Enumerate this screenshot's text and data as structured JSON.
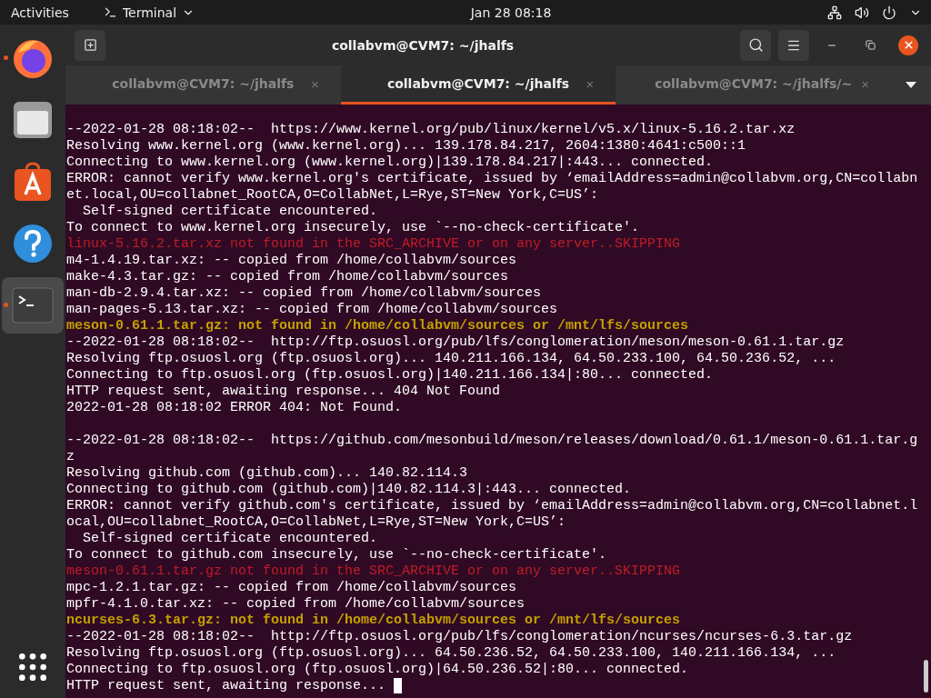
{
  "top_bar": {
    "activities": "Activities",
    "app_menu": "Terminal",
    "clock": "Jan 28  08:18"
  },
  "dock": [
    {
      "kind": "browser",
      "running": true,
      "focused": false
    },
    {
      "kind": "files",
      "running": false,
      "focused": false
    },
    {
      "kind": "software",
      "running": false,
      "focused": false
    },
    {
      "kind": "help",
      "running": false,
      "focused": false
    },
    {
      "kind": "terminal",
      "running": true,
      "focused": true
    }
  ],
  "window": {
    "title": "collabvm@CVM7: ~/jhalfs"
  },
  "tabs": [
    {
      "label": "collabvm@CVM7: ~/jhalfs",
      "close": "×",
      "selected": false
    },
    {
      "label": "collabvm@CVM7: ~/jhalfs",
      "close": "×",
      "selected": true
    },
    {
      "label": "collabvm@CVM7: ~/jhalfs/~",
      "close": "×",
      "selected": false
    }
  ],
  "terminal": {
    "cursor_visible": true,
    "lines": [
      {
        "kind": "normal",
        "text": "--2022-01-28 08:18:02--  https://www.kernel.org/pub/linux/kernel/v5.x/linux-5.16.2.tar.xz"
      },
      {
        "kind": "normal",
        "text": "Resolving www.kernel.org (www.kernel.org)... 139.178.84.217, 2604:1380:4641:c500::1"
      },
      {
        "kind": "normal",
        "text": "Connecting to www.kernel.org (www.kernel.org)|139.178.84.217|:443... connected."
      },
      {
        "kind": "normal",
        "text": "ERROR: cannot verify www.kernel.org's certificate, issued by ‘emailAddress=admin@collabvm.org,CN=collabn"
      },
      {
        "kind": "normal",
        "text": "et.local,OU=collabnet_RootCA,O=CollabNet,L=Rye,ST=New York,C=US’:"
      },
      {
        "kind": "normal",
        "text": "  Self-signed certificate encountered."
      },
      {
        "kind": "normal",
        "text": "To connect to www.kernel.org insecurely, use `--no-check-certificate'."
      },
      {
        "kind": "error",
        "text": "linux-5.16.2.tar.xz not found in the SRC_ARCHIVE or on any server..SKIPPING"
      },
      {
        "kind": "normal",
        "text": "m4-1.4.19.tar.xz: -- copied from /home/collabvm/sources"
      },
      {
        "kind": "normal",
        "text": "make-4.3.tar.gz: -- copied from /home/collabvm/sources"
      },
      {
        "kind": "normal",
        "text": "man-db-2.9.4.tar.xz: -- copied from /home/collabvm/sources"
      },
      {
        "kind": "normal",
        "text": "man-pages-5.13.tar.xz: -- copied from /home/collabvm/sources"
      },
      {
        "kind": "warning",
        "text": "meson-0.61.1.tar.gz: not found in /home/collabvm/sources or /mnt/lfs/sources"
      },
      {
        "kind": "normal",
        "text": "--2022-01-28 08:18:02--  http://ftp.osuosl.org/pub/lfs/conglomeration/meson/meson-0.61.1.tar.gz"
      },
      {
        "kind": "normal",
        "text": "Resolving ftp.osuosl.org (ftp.osuosl.org)... 140.211.166.134, 64.50.233.100, 64.50.236.52, ..."
      },
      {
        "kind": "normal",
        "text": "Connecting to ftp.osuosl.org (ftp.osuosl.org)|140.211.166.134|:80... connected."
      },
      {
        "kind": "normal",
        "text": "HTTP request sent, awaiting response... 404 Not Found"
      },
      {
        "kind": "normal",
        "text": "2022-01-28 08:18:02 ERROR 404: Not Found."
      },
      {
        "kind": "blank"
      },
      {
        "kind": "normal",
        "text": "--2022-01-28 08:18:02--  https://github.com/mesonbuild/meson/releases/download/0.61.1/meson-0.61.1.tar.g"
      },
      {
        "kind": "normal",
        "text": "z"
      },
      {
        "kind": "normal",
        "text": "Resolving github.com (github.com)... 140.82.114.3"
      },
      {
        "kind": "normal",
        "text": "Connecting to github.com (github.com)|140.82.114.3|:443... connected."
      },
      {
        "kind": "normal",
        "text": "ERROR: cannot verify github.com's certificate, issued by ‘emailAddress=admin@collabvm.org,CN=collabnet.l"
      },
      {
        "kind": "normal",
        "text": "ocal,OU=collabnet_RootCA,O=CollabNet,L=Rye,ST=New York,C=US’:"
      },
      {
        "kind": "normal",
        "text": "  Self-signed certificate encountered."
      },
      {
        "kind": "normal",
        "text": "To connect to github.com insecurely, use `--no-check-certificate'."
      },
      {
        "kind": "error",
        "text": "meson-0.61.1.tar.gz not found in the SRC_ARCHIVE or on any server..SKIPPING"
      },
      {
        "kind": "normal",
        "text": "mpc-1.2.1.tar.gz: -- copied from /home/collabvm/sources"
      },
      {
        "kind": "normal",
        "text": "mpfr-4.1.0.tar.xz: -- copied from /home/collabvm/sources"
      },
      {
        "kind": "warning",
        "text": "ncurses-6.3.tar.gz: not found in /home/collabvm/sources or /mnt/lfs/sources"
      },
      {
        "kind": "normal",
        "text": "--2022-01-28 08:18:02--  http://ftp.osuosl.org/pub/lfs/conglomeration/ncurses/ncurses-6.3.tar.gz"
      },
      {
        "kind": "normal",
        "text": "Resolving ftp.osuosl.org (ftp.osuosl.org)... 64.50.236.52, 64.50.233.100, 140.211.166.134, ..."
      },
      {
        "kind": "normal",
        "text": "Connecting to ftp.osuosl.org (ftp.osuosl.org)|64.50.236.52|:80... connected."
      },
      {
        "kind": "normal",
        "text": "HTTP request sent, awaiting response... "
      }
    ]
  }
}
